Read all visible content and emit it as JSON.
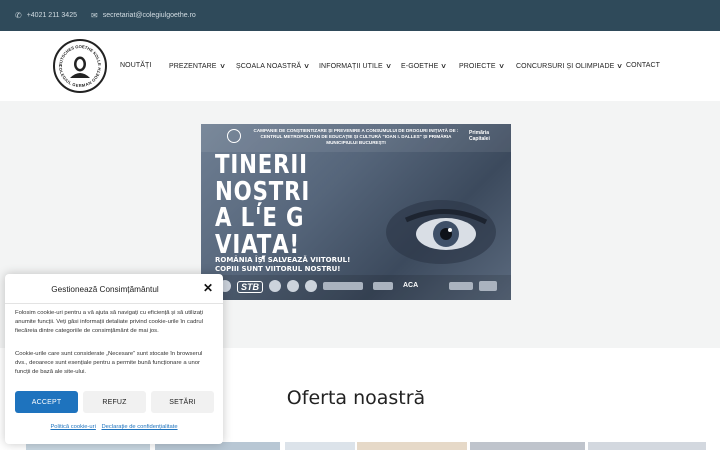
{
  "topbar": {
    "phone": "+4021 211 3425",
    "email": "secretariat@colegiulgoethe.ro",
    "phone_icon": "phone-icon",
    "email_icon": "envelope-icon",
    "background": "#2f4a5a"
  },
  "logo": {
    "top_text": "DEUTSCHES GOETHE KOLLEG",
    "bottom_text": "COLEGIUL GERMAN GOETHE"
  },
  "nav": {
    "items": [
      {
        "label": "NOUTĂȚI",
        "dropdown": false
      },
      {
        "label": "PREZENTARE",
        "dropdown": true
      },
      {
        "label": "ȘCOALA NOASTRĂ",
        "dropdown": true
      },
      {
        "label": "INFORMAȚII UTILE",
        "dropdown": true
      },
      {
        "label": "E-GOETHE",
        "dropdown": true
      },
      {
        "label": "PROIECTE",
        "dropdown": true
      },
      {
        "label": "CONCURSURI ȘI OLIMPIADE",
        "dropdown": true
      },
      {
        "label": "CONTACT",
        "dropdown": false
      }
    ]
  },
  "banner": {
    "header_text": "CAMPANIE DE CONȘTIENTIZARE ȘI PREVENIRE A CONSUMULUI DE DROGURI INIȚIATĂ DE : CENTRUL METROPOLITAN DE EDUCAȚIE ȘI CULTURĂ \"IOAN I. DALLES\" ȘI PRIMĂRIA MUNICIPIULUI BUCUREȘTI",
    "capital_label": "Primăria Capitalei",
    "headline_lines": [
      "TINERII",
      "NOȘTRI",
      "A L'E G",
      "VIAȚA!"
    ],
    "sub_lines": [
      "ROMÂNIA ÎȘI SALVEAZĂ VIITORUL!",
      "COPIII SUNT VIITORUL NOSTRU!"
    ],
    "logo_stb": "STB",
    "logo_aca": "ACA"
  },
  "section": {
    "title": "Oferta noastră"
  },
  "cookie": {
    "title": "Gestionează Consimțământul",
    "close_icon": "close-icon",
    "paragraph1": "Folosim cookie-uri pentru a vă ajuta să navigați cu eficiență și să utilizați anumite funcții. Veți găsi informații detaliate privind cookie-urile în cadrul fiecăreia dintre categoriile de consimțământ de mai jos.",
    "paragraph2": "Cookie-urile care sunt considerate „Necesare” sunt stocate în browserul dvs., deoarece sunt esențiale pentru a permite bună funcționare a unor funcții de bază ale site-ului.",
    "accept_label": "ACCEPT",
    "deny_label": "REFUZ",
    "settings_label": "SETĂRI",
    "cookie_policy_link": "Politică cookie-uri",
    "privacy_link": "Declarație de confidențialitate",
    "accent": "#1e73be"
  }
}
